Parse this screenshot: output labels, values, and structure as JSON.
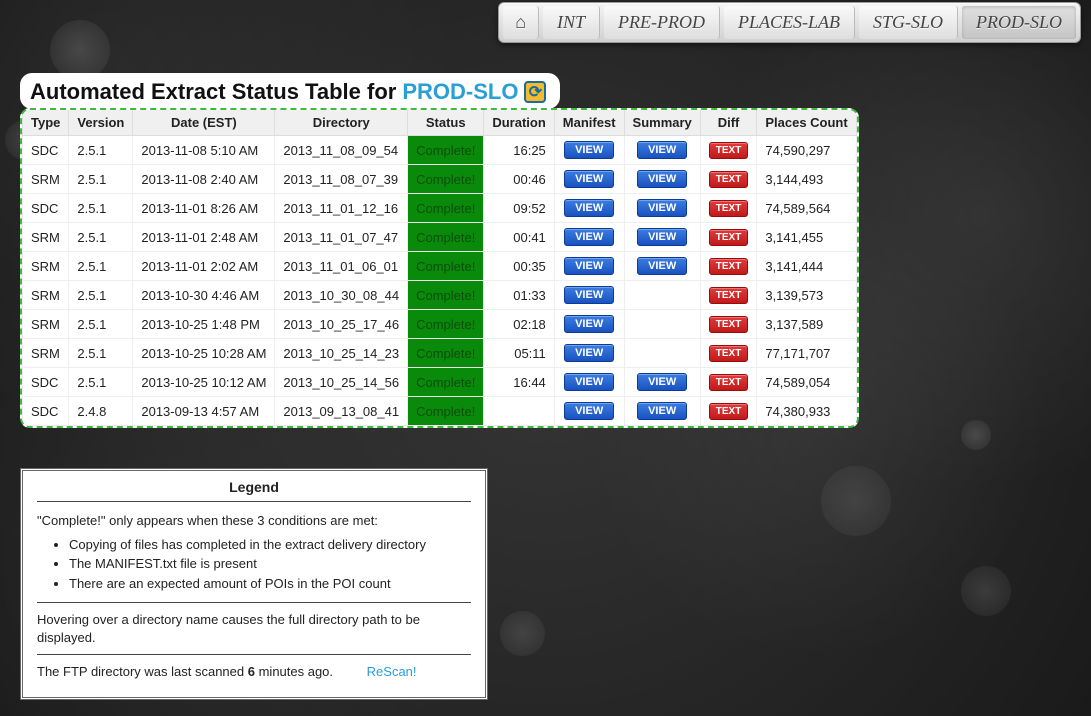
{
  "nav": {
    "home_glyph": "⌂",
    "tabs": [
      {
        "label": "INT"
      },
      {
        "label": "PRE-PROD"
      },
      {
        "label": "PLACES-LAB"
      },
      {
        "label": "STG-SLO"
      },
      {
        "label": "PROD-SLO",
        "active": true
      }
    ]
  },
  "heading": {
    "prefix": "Automated Extract Status Table for ",
    "env": "PROD-SLO",
    "refresh_glyph": "⟳"
  },
  "table": {
    "headers": [
      "Type",
      "Version",
      "Date (EST)",
      "Directory",
      "Status",
      "Duration",
      "Manifest",
      "Summary",
      "Diff",
      "Places Count"
    ],
    "view_label": "VIEW",
    "text_label": "TEXT",
    "rows": [
      {
        "type": "SDC",
        "version": "2.5.1",
        "date": "2013-11-08 5:10 AM",
        "dir": "2013_11_08_09_54",
        "status": "Complete!",
        "duration": "16:25",
        "manifest": true,
        "summary": true,
        "diff": true,
        "count": "74,590,297"
      },
      {
        "type": "SRM",
        "version": "2.5.1",
        "date": "2013-11-08 2:40 AM",
        "dir": "2013_11_08_07_39",
        "status": "Complete!",
        "duration": "00:46",
        "manifest": true,
        "summary": true,
        "diff": true,
        "count": "3,144,493"
      },
      {
        "type": "SDC",
        "version": "2.5.1",
        "date": "2013-11-01 8:26 AM",
        "dir": "2013_11_01_12_16",
        "status": "Complete!",
        "duration": "09:52",
        "manifest": true,
        "summary": true,
        "diff": true,
        "count": "74,589,564"
      },
      {
        "type": "SRM",
        "version": "2.5.1",
        "date": "2013-11-01 2:48 AM",
        "dir": "2013_11_01_07_47",
        "status": "Complete!",
        "duration": "00:41",
        "manifest": true,
        "summary": true,
        "diff": true,
        "count": "3,141,455"
      },
      {
        "type": "SRM",
        "version": "2.5.1",
        "date": "2013-11-01 2:02 AM",
        "dir": "2013_11_01_06_01",
        "status": "Complete!",
        "duration": "00:35",
        "manifest": true,
        "summary": true,
        "diff": true,
        "count": "3,141,444"
      },
      {
        "type": "SRM",
        "version": "2.5.1",
        "date": "2013-10-30 4:46 AM",
        "dir": "2013_10_30_08_44",
        "status": "Complete!",
        "duration": "01:33",
        "manifest": true,
        "summary": false,
        "diff": true,
        "count": "3,139,573"
      },
      {
        "type": "SRM",
        "version": "2.5.1",
        "date": "2013-10-25 1:48 PM",
        "dir": "2013_10_25_17_46",
        "status": "Complete!",
        "duration": "02:18",
        "manifest": true,
        "summary": false,
        "diff": true,
        "count": "3,137,589"
      },
      {
        "type": "SRM",
        "version": "2.5.1",
        "date": "2013-10-25 10:28 AM",
        "dir": "2013_10_25_14_23",
        "status": "Complete!",
        "duration": "05:11",
        "manifest": true,
        "summary": false,
        "diff": true,
        "count": "77,171,707"
      },
      {
        "type": "SDC",
        "version": "2.5.1",
        "date": "2013-10-25 10:12 AM",
        "dir": "2013_10_25_14_56",
        "status": "Complete!",
        "duration": "16:44",
        "manifest": true,
        "summary": true,
        "diff": true,
        "count": "74,589,054"
      },
      {
        "type": "SDC",
        "version": "2.4.8",
        "date": "2013-09-13 4:57 AM",
        "dir": "2013_09_13_08_41",
        "status": "Complete!",
        "duration": "",
        "manifest": true,
        "summary": true,
        "diff": true,
        "count": "74,380,933"
      }
    ]
  },
  "legend": {
    "title": "Legend",
    "intro": "\"Complete!\" only appears when these 3 conditions are met:",
    "conditions": [
      "Copying of files has completed in the extract delivery directory",
      "The MANIFEST.txt file is present",
      "There are an expected amount of POIs in the POI count"
    ],
    "hover_note": "Hovering over a directory name causes the full directory path to be displayed.",
    "ftp_prefix": "The FTP directory was last scanned ",
    "ftp_age": "6",
    "ftp_suffix": " minutes ago.",
    "rescan_label": "ReScan!"
  }
}
